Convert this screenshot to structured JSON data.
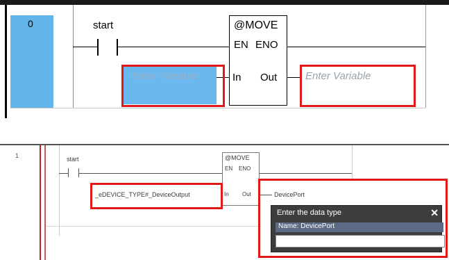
{
  "top": {
    "rung_number": "0",
    "contact_label": "start",
    "block_name": "@MOVE",
    "pin_en": "EN",
    "pin_eno": "ENO",
    "pin_in": "In",
    "pin_out": "Out",
    "in_placeholder": "Enter Variable",
    "out_placeholder": "Enter Variable"
  },
  "bottom": {
    "rung_number": "1",
    "contact_label": "start",
    "block_name": "@MOVE",
    "pin_en": "EN",
    "pin_eno": "ENO",
    "pin_in": "In",
    "pin_out": "Out",
    "in_value": "_eDEVICE_TYPE#_DeviceOutput",
    "out_value": "DevicePort",
    "popup_title": "Enter the data type",
    "popup_name": "Name: DevicePort",
    "popup_input": ""
  },
  "colors": {
    "highlight": "#e01919",
    "rung_column": "#63b4e8",
    "popup_bg": "#3d3d3d"
  }
}
